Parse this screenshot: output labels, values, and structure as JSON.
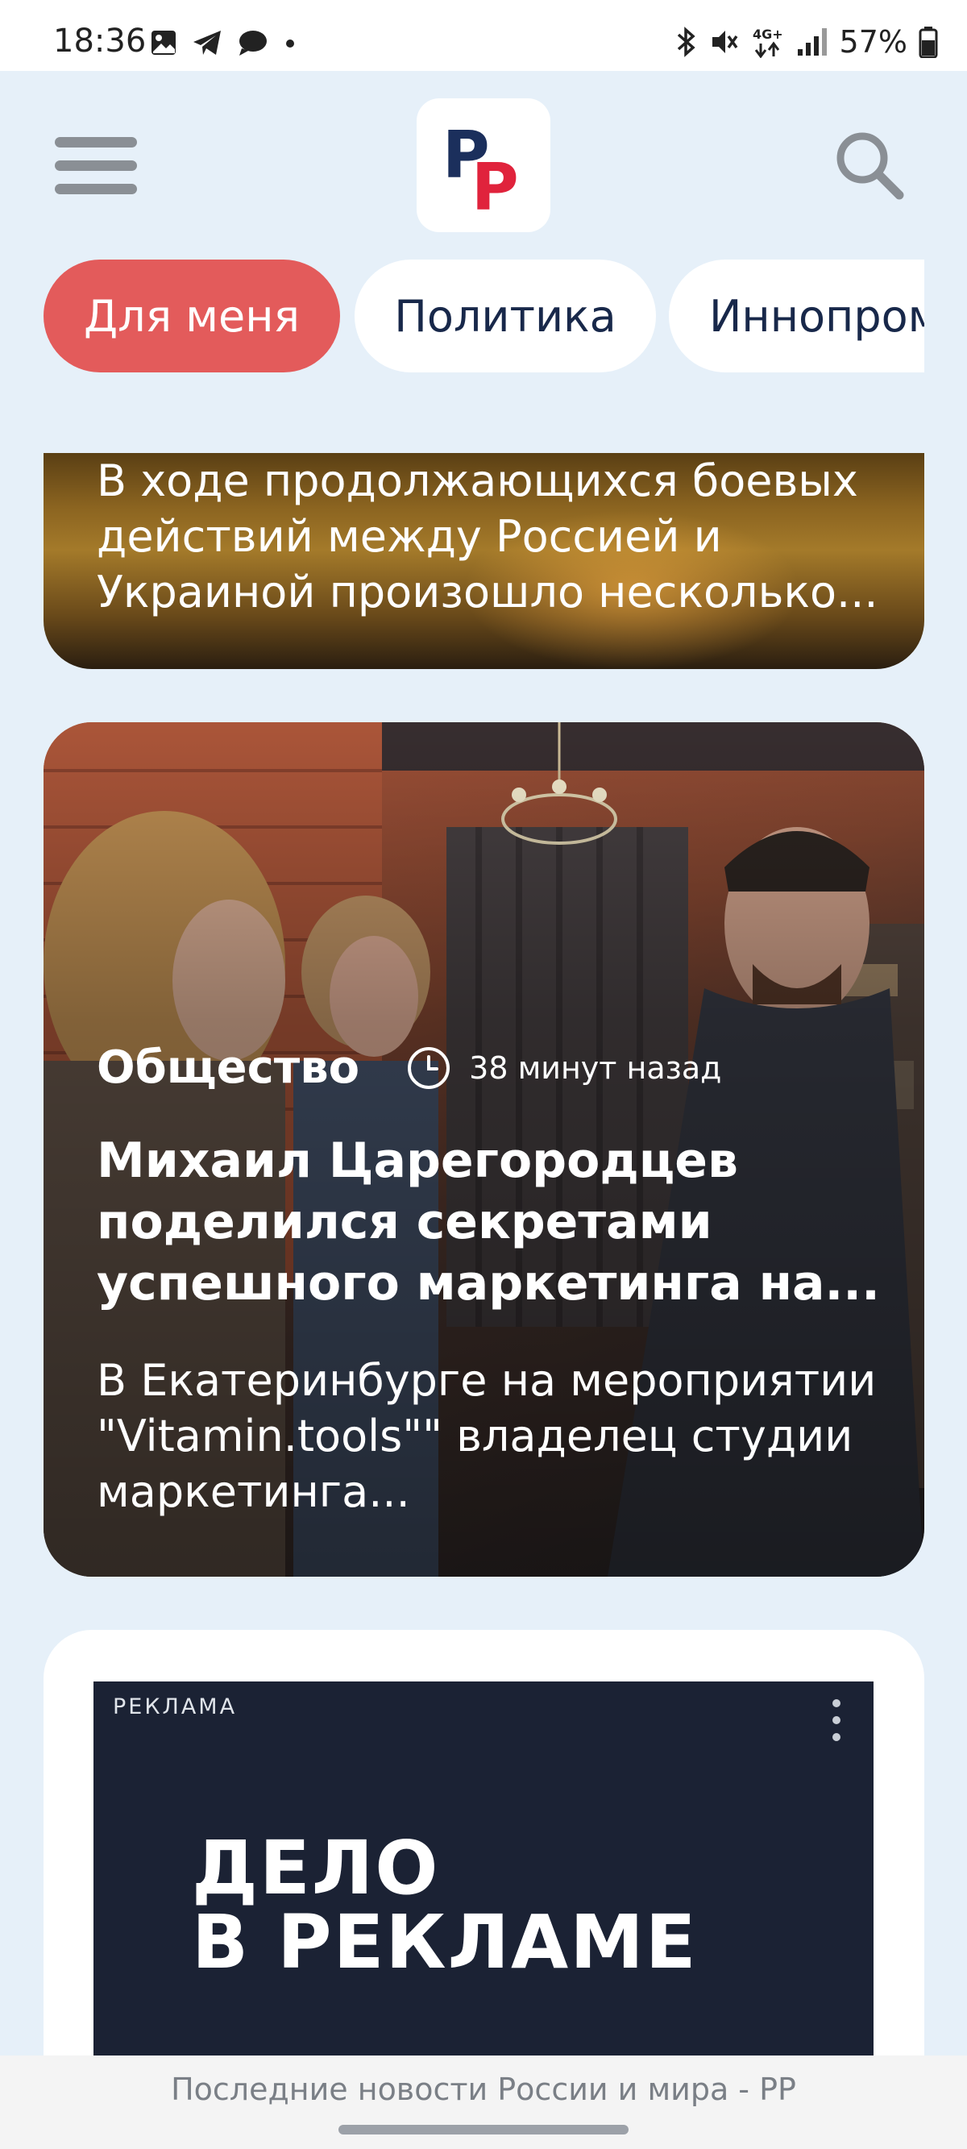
{
  "status_bar": {
    "time": "18:36",
    "battery_text": "57%",
    "network": "4G+",
    "icons_left": [
      "image-icon",
      "telegram-icon",
      "chat-icon",
      "dot-icon"
    ],
    "icons_right": [
      "bluetooth-icon",
      "mute-icon",
      "network-icon",
      "signal-icon",
      "battery-icon"
    ]
  },
  "header": {
    "logo_letters": [
      "Р",
      "Р"
    ],
    "menu_icon": "hamburger-icon",
    "search_icon": "search-icon"
  },
  "tabs": [
    {
      "label": "Для меня",
      "active": true
    },
    {
      "label": "Политика",
      "active": false
    },
    {
      "label": "Иннопром",
      "active": false
    }
  ],
  "feed": {
    "card_top": {
      "excerpt": "В ходе продолжающихся боевых действий между Россией и Украиной произошло несколько..."
    },
    "card_photo": {
      "category": "Общество",
      "time_ago": "38 минут назад",
      "headline": "Михаил Царегородцев поделился секретами успешного маркетинга на...",
      "excerpt": "В Екатеринбурге на мероприятии \"Vitamin.tools\"\" владелец студии маркетинга..."
    },
    "ad": {
      "label": "РЕКЛАМА",
      "line1": "ДЕЛО",
      "line2": "В РЕКЛАМЕ"
    }
  },
  "footer": {
    "page_title": "Последние новости России и мира - РР"
  },
  "colors": {
    "accent": "#e35b5b",
    "background": "#e6f0f9",
    "logo_blue": "#1b2f5c",
    "logo_red": "#e0233c",
    "ad_background": "#1b2234"
  }
}
